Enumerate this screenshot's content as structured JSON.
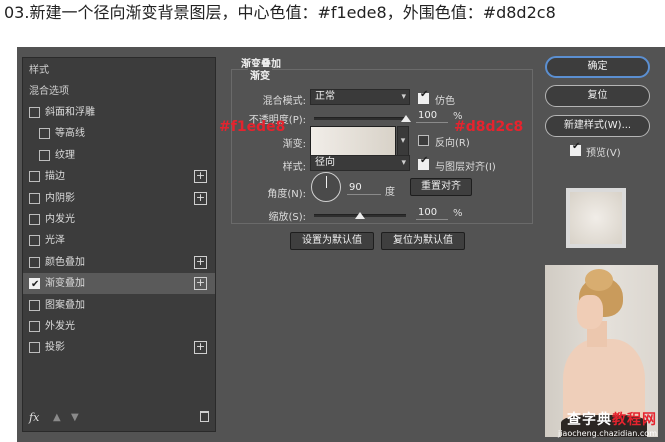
{
  "caption": "03.新建一个径向渐变背景图层，中心色值：#f1ede8，外围色值：#d8d2c8",
  "styles_list": {
    "header": "样式",
    "blend_options": "混合选项",
    "items": [
      {
        "label": "斜面和浮雕",
        "checked": false,
        "indent": false,
        "plus": false
      },
      {
        "label": "等高线",
        "checked": false,
        "indent": true,
        "plus": false
      },
      {
        "label": "纹理",
        "checked": false,
        "indent": true,
        "plus": false
      },
      {
        "label": "描边",
        "checked": false,
        "indent": false,
        "plus": true
      },
      {
        "label": "内阴影",
        "checked": false,
        "indent": false,
        "plus": true
      },
      {
        "label": "内发光",
        "checked": false,
        "indent": false,
        "plus": false
      },
      {
        "label": "光泽",
        "checked": false,
        "indent": false,
        "plus": false
      },
      {
        "label": "颜色叠加",
        "checked": false,
        "indent": false,
        "plus": true
      },
      {
        "label": "渐变叠加",
        "checked": true,
        "indent": false,
        "plus": true,
        "selected": true
      },
      {
        "label": "图案叠加",
        "checked": false,
        "indent": false,
        "plus": false
      },
      {
        "label": "外发光",
        "checked": false,
        "indent": false,
        "plus": false
      },
      {
        "label": "投影",
        "checked": false,
        "indent": false,
        "plus": true
      }
    ],
    "fx_label": "fx"
  },
  "gradient_overlay": {
    "title": "渐变叠加",
    "subtitle": "渐变",
    "blend_mode_label": "混合模式:",
    "blend_mode_value": "正常",
    "dither_label": "仿色",
    "dither_checked": true,
    "opacity_label": "不透明度(P):",
    "opacity_value": "100",
    "opacity_unit": "%",
    "opacity_fraction": 1.0,
    "gradient_label": "渐变:",
    "gradient_center_color": "#f1ede8",
    "gradient_outer_color": "#d8d2c8",
    "reverse_label": "反向(R)",
    "reverse_checked": false,
    "style_label": "样式:",
    "style_value": "径向",
    "align_label": "与图层对齐(I)",
    "align_checked": true,
    "angle_label": "角度(N):",
    "angle_value": "90",
    "angle_unit": "度",
    "reset_align_button": "重置对齐",
    "scale_label": "缩放(S):",
    "scale_value": "100",
    "scale_unit": "%",
    "scale_fraction": 0.5,
    "set_default_button": "设置为默认值",
    "reset_default_button": "复位为默认值"
  },
  "annotations": {
    "center": "#f1ede8",
    "outer": "#d8d2c8"
  },
  "right_panel": {
    "ok_button": "确定",
    "reset_button": "复位",
    "new_style_button": "新建样式(W)...",
    "preview_label": "预览(V)",
    "preview_checked": true
  },
  "watermark": {
    "main_a": "查字典",
    "main_b": "教程网",
    "sub": "jiaocheng.chazidian.com"
  }
}
